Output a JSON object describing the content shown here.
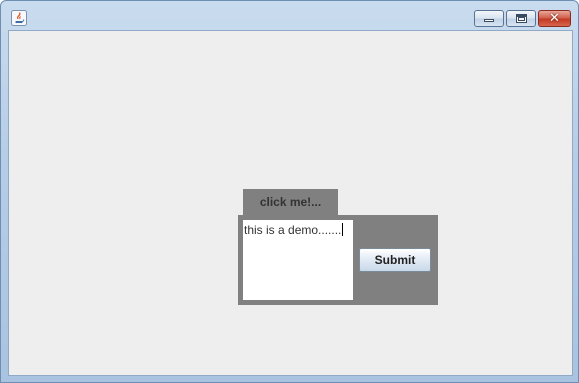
{
  "window": {
    "app_icon": "java-cup-icon",
    "controls": {
      "minimize_icon": "minimize-icon",
      "maximize_icon": "maximize-icon",
      "close_icon": "close-icon",
      "close_glyph": "✕"
    }
  },
  "content": {
    "tab_label": "click me!...",
    "textarea_value": "this is a demo.......",
    "submit_label": "Submit"
  },
  "colors": {
    "client_background": "#eeeeee",
    "panel_background": "#808080",
    "textarea_background": "#ffffff",
    "close_button": "#c33a24"
  }
}
